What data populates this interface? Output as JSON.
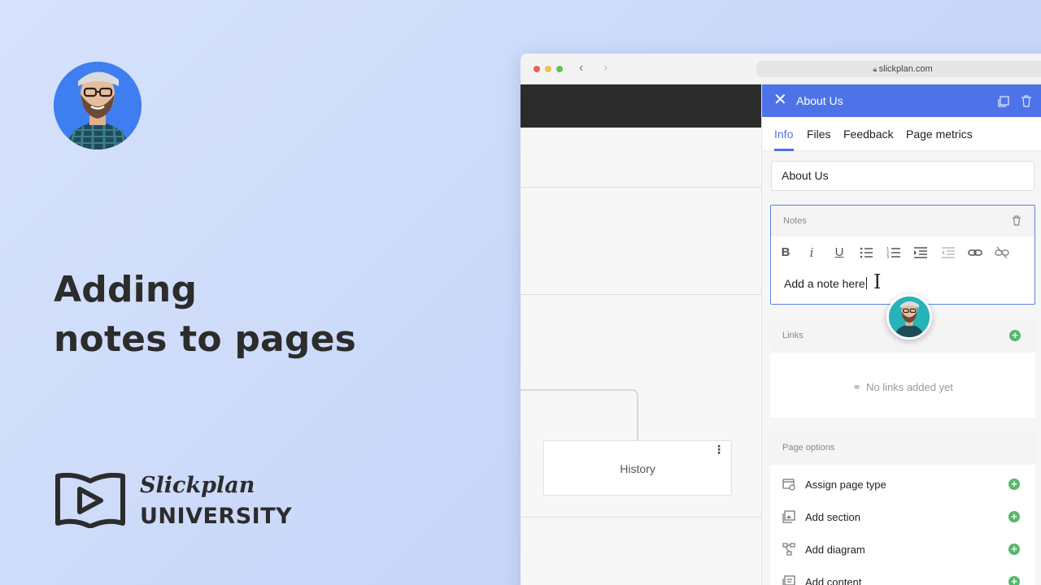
{
  "headline": {
    "line1": "Adding",
    "line2": "notes to pages"
  },
  "brand": {
    "script": "Slickplan",
    "university": "UNIVERSITY"
  },
  "browser": {
    "url": "slickplan.com"
  },
  "canvas": {
    "history_label": "History"
  },
  "panel": {
    "title": "About Us",
    "tabs": [
      {
        "label": "Info",
        "active": true
      },
      {
        "label": "Files"
      },
      {
        "label": "Feedback"
      },
      {
        "label": "Page metrics"
      }
    ],
    "page_name": "About Us",
    "notes": {
      "label": "Notes",
      "text": "Add a note here"
    },
    "links": {
      "label": "Links",
      "empty": "No links added yet"
    },
    "page_options": {
      "label": "Page options",
      "items": [
        {
          "label": "Assign page type",
          "icon": "page-type-icon"
        },
        {
          "label": "Add section",
          "icon": "section-icon"
        },
        {
          "label": "Add diagram",
          "icon": "diagram-icon"
        },
        {
          "label": "Add content",
          "icon": "content-icon"
        }
      ]
    }
  },
  "colors": {
    "accent": "#4e73e8",
    "green": "#55b86a",
    "avatar_bg": "#3f7ef0"
  }
}
